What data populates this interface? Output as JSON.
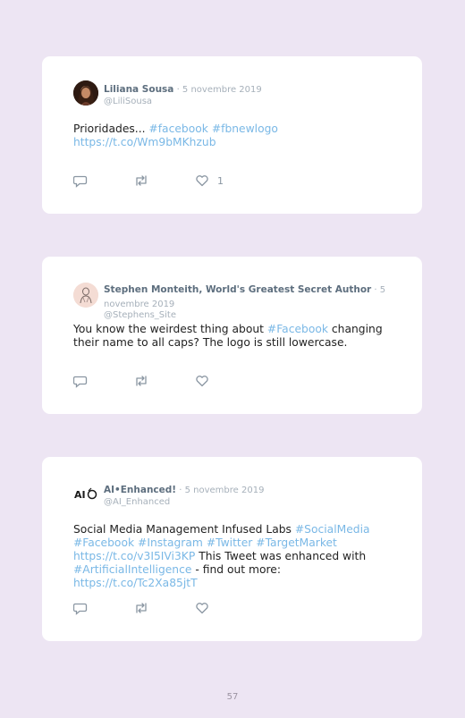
{
  "tweets": [
    {
      "name": "Liliana Sousa",
      "date": " · 5 novembre 2019",
      "handle": "@LiliSousa",
      "text": [
        {
          "t": "Prioridades... ",
          "link": false
        },
        {
          "t": "#facebook",
          "link": true
        },
        {
          "t": " ",
          "link": false
        },
        {
          "t": "#fbnewlogo",
          "link": true
        },
        {
          "t": " ",
          "link": false
        },
        {
          "t": "https://t.co/Wm9bMKhzub",
          "link": true
        }
      ],
      "likes": "1",
      "avatar_icon": "profile-photo"
    },
    {
      "name": "Stephen Monteith, World's Greatest Secret Author",
      "date": " · 5 novembre 2019",
      "handle": "@Stephens_Site",
      "text": [
        {
          "t": "You know the weirdest thing about ",
          "link": false
        },
        {
          "t": "#Facebook",
          "link": true
        },
        {
          "t": " changing their name to all caps? The logo is still lowercase.",
          "link": false
        }
      ],
      "likes": "",
      "avatar_icon": "sketch-portrait"
    },
    {
      "name": "AI•Enhanced!",
      "date": " · 5 novembre 2019",
      "handle": "@AI_Enhanced",
      "text": [
        {
          "t": "Social Media Management Infused Labs ",
          "link": false
        },
        {
          "t": "#SocialMedia",
          "link": true
        },
        {
          "t": " ",
          "link": false
        },
        {
          "t": "#Facebook",
          "link": true
        },
        {
          "t": " ",
          "link": false
        },
        {
          "t": "#Instagram",
          "link": true
        },
        {
          "t": " ",
          "link": false
        },
        {
          "t": "#Twitter",
          "link": true
        },
        {
          "t": " ",
          "link": false
        },
        {
          "t": "#TargetMarket",
          "link": true
        },
        {
          "t": " ",
          "link": false
        },
        {
          "t": "https://t.co/v3I5IVi3KP",
          "link": true
        },
        {
          "t": " This Tweet was enhanced with ",
          "link": false
        },
        {
          "t": "#ArtificialIntelligence",
          "link": true
        },
        {
          "t": " - find out more: ",
          "link": false
        },
        {
          "t": "https://t.co/Tc2Xa85jtT",
          "link": true
        }
      ],
      "likes": "",
      "avatar_icon": "ai-logo",
      "avatar_text": "AI"
    }
  ],
  "page_number": "57",
  "colors": {
    "background": "#ede5f3",
    "link": "#7ab8e6",
    "name": "#5d6e7e",
    "muted": "#a6b0ba"
  }
}
